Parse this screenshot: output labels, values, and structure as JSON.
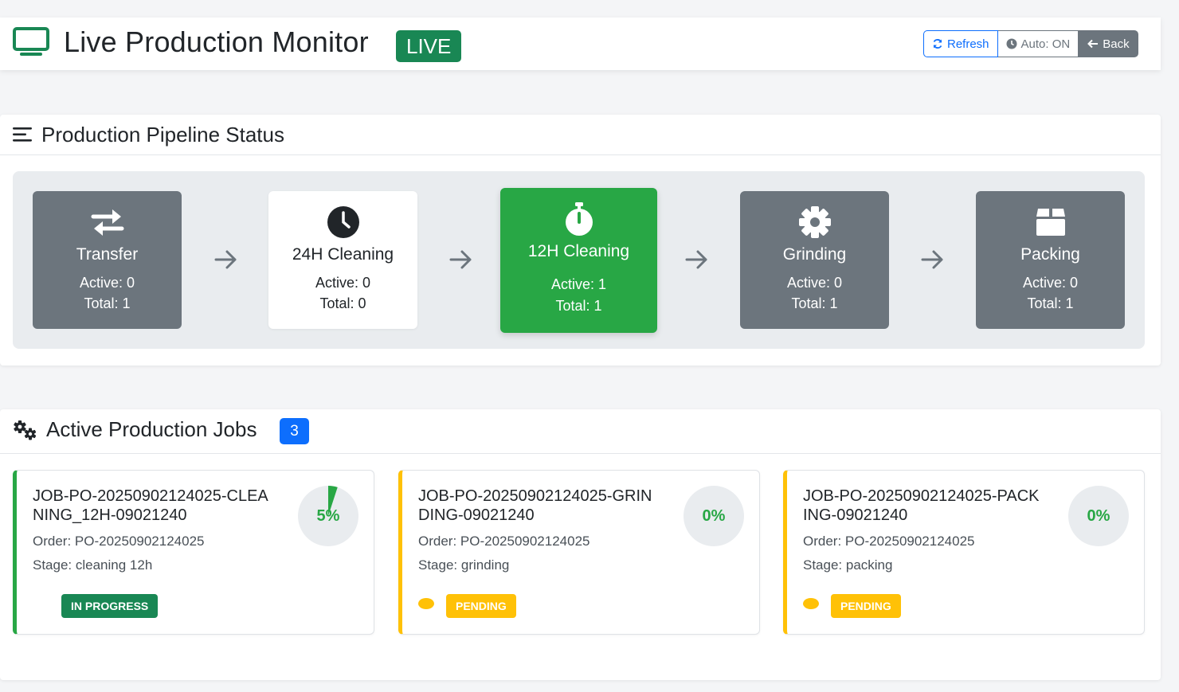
{
  "header": {
    "title": "Live Production Monitor",
    "live_badge": "LIVE",
    "buttons": {
      "refresh": "Refresh",
      "auto": "Auto: ON",
      "back": "Back"
    }
  },
  "pipeline": {
    "title": "Production Pipeline Status",
    "stages": [
      {
        "name": "Transfer",
        "active": "Active: 0",
        "total": "Total: 1",
        "icon": "transfer-arrows-icon",
        "state": "gray"
      },
      {
        "name": "24H Cleaning",
        "active": "Active: 0",
        "total": "Total: 0",
        "icon": "clock-icon",
        "state": "white"
      },
      {
        "name": "12H Cleaning",
        "active": "Active: 1",
        "total": "Total: 1",
        "icon": "stopwatch-icon",
        "state": "active"
      },
      {
        "name": "Grinding",
        "active": "Active: 0",
        "total": "Total: 1",
        "icon": "gear-icon",
        "state": "gray"
      },
      {
        "name": "Packing",
        "active": "Active: 0",
        "total": "Total: 1",
        "icon": "box-icon",
        "state": "gray"
      }
    ]
  },
  "jobs": {
    "title": "Active Production Jobs",
    "count": "3",
    "items": [
      {
        "name": "JOB-PO-20250902124025-CLEANING_12H-09021240",
        "order": "Order: PO-20250902124025",
        "stage": "Stage: cleaning 12h",
        "progress_label": "5%",
        "progress": 0.05,
        "status": "IN PROGRESS"
      },
      {
        "name": "JOB-PO-20250902124025-GRINDING-09021240",
        "order": "Order: PO-20250902124025",
        "stage": "Stage: grinding",
        "progress_label": "0%",
        "progress": 0,
        "status": "PENDING"
      },
      {
        "name": "JOB-PO-20250902124025-PACKING-09021240",
        "order": "Order: PO-20250902124025",
        "stage": "Stage: packing",
        "progress_label": "0%",
        "progress": 0,
        "status": "PENDING"
      }
    ]
  },
  "colors": {
    "success": "#28a745",
    "dark_success": "#198754",
    "warning": "#ffc107",
    "primary": "#0d6efd",
    "secondary": "#6c757d"
  }
}
